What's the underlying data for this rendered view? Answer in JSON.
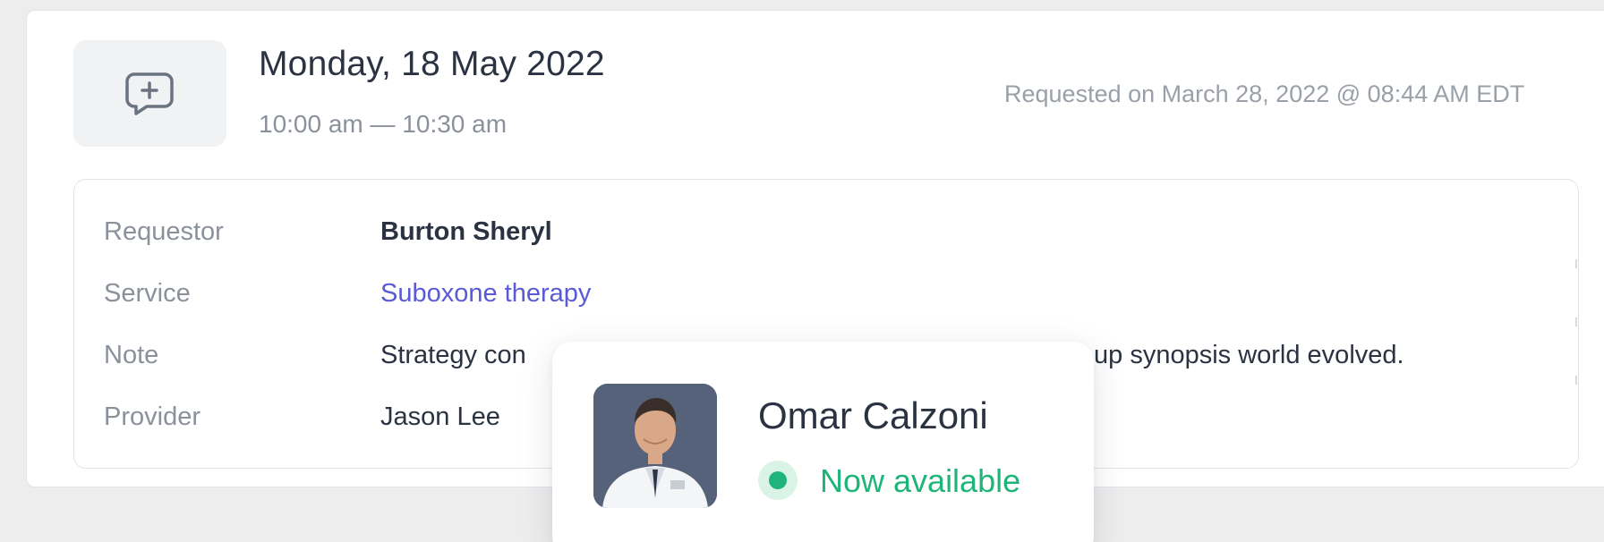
{
  "appointment": {
    "date": "Monday, 18 May 2022",
    "time_range": "10:00 am — 10:30 am",
    "requested_on": "Requested on March 28, 2022 @ 08:44 AM EDT",
    "icon": "chat-plus-icon"
  },
  "details": {
    "rows": [
      {
        "label": "Requestor",
        "value": "Burton Sheryl"
      },
      {
        "label": "Service",
        "value": "Suboxone therapy"
      },
      {
        "label": "Note",
        "value": "Strategy con"
      },
      {
        "label": "Provider",
        "value": "Jason Lee"
      }
    ],
    "note_tail": "up synopsis world evolved."
  },
  "popover": {
    "name": "Omar Calzoni",
    "status": "Now available",
    "status_color": "#1fb57a"
  },
  "colors": {
    "link": "#5a5ad6",
    "text_primary": "#2b3342",
    "text_muted": "#8b919b"
  }
}
